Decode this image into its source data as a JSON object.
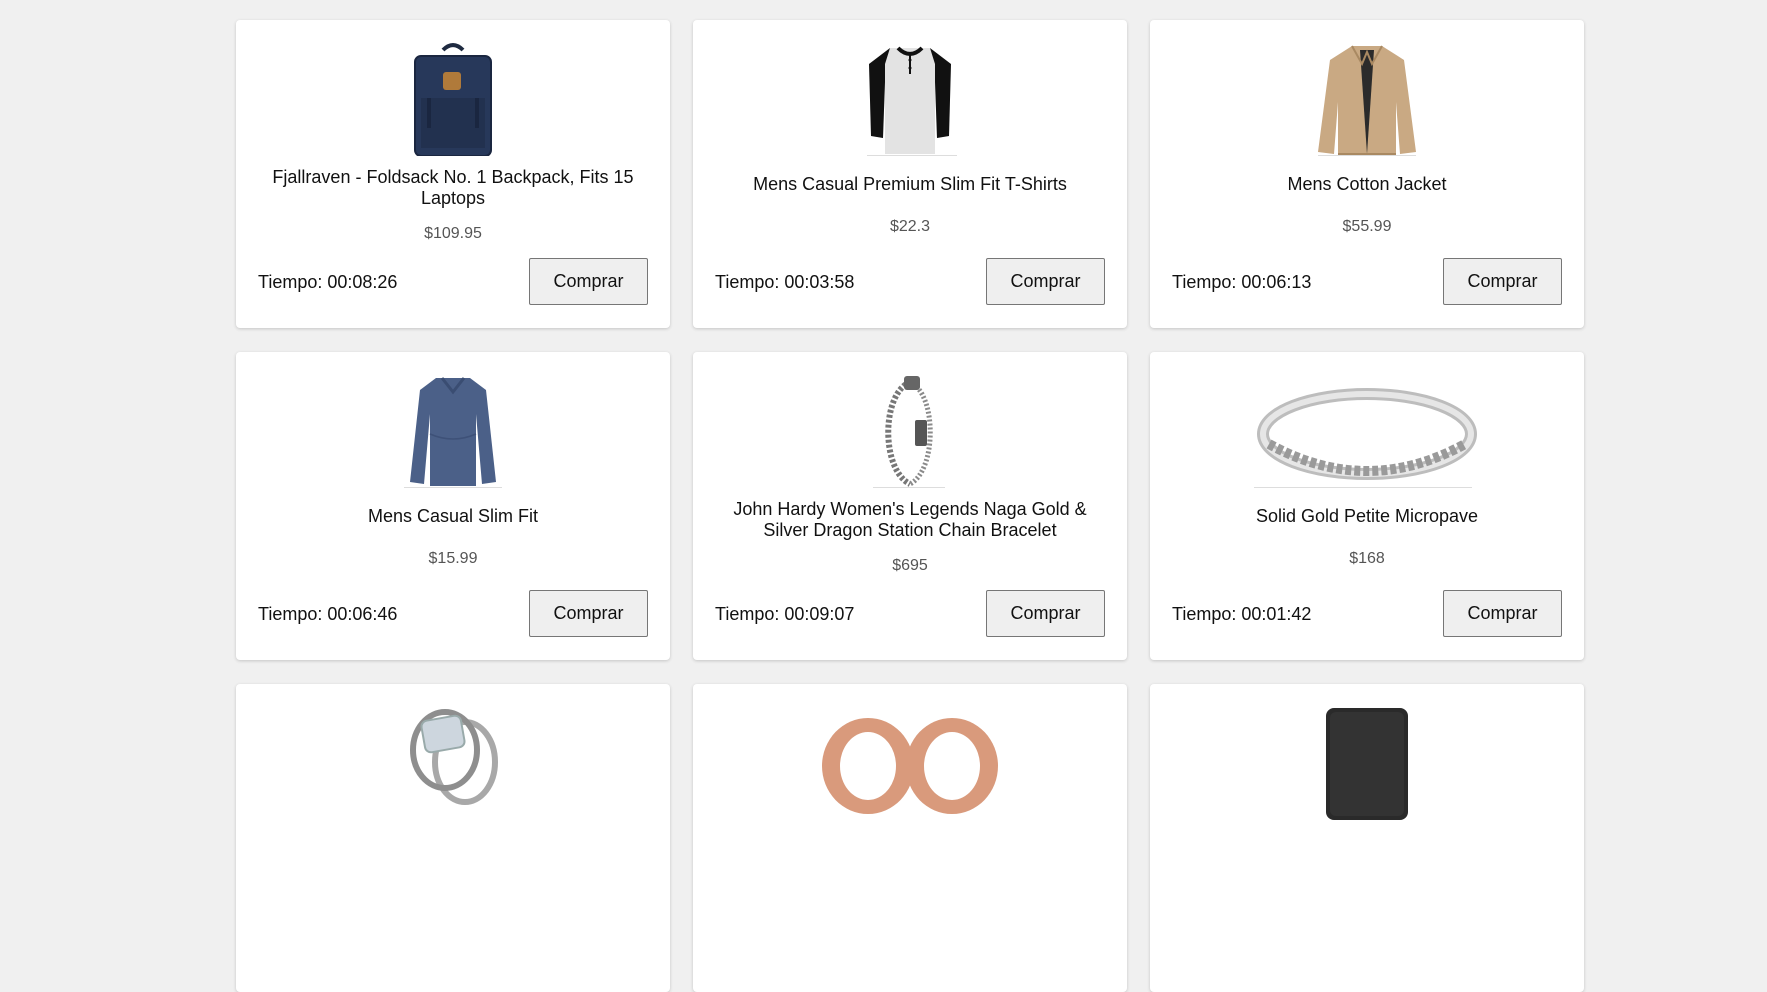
{
  "products": [
    {
      "title": "Fjallraven - Foldsack No. 1 Backpack, Fits 15 Laptops",
      "price": "$109.95",
      "timer": "Tiempo: 00:08:26",
      "button": "Comprar",
      "image": "backpack"
    },
    {
      "title": "Mens Casual Premium Slim Fit T-Shirts",
      "price": "$22.3",
      "timer": "Tiempo: 00:03:58",
      "button": "Comprar",
      "image": "tshirt"
    },
    {
      "title": "Mens Cotton Jacket",
      "price": "$55.99",
      "timer": "Tiempo: 00:06:13",
      "button": "Comprar",
      "image": "jacket"
    },
    {
      "title": "Mens Casual Slim Fit",
      "price": "$15.99",
      "timer": "Tiempo: 00:06:46",
      "button": "Comprar",
      "image": "longsleeve"
    },
    {
      "title": "John Hardy Women's Legends Naga Gold & Silver Dragon Station Chain Bracelet",
      "price": "$695",
      "timer": "Tiempo: 00:09:07",
      "button": "Comprar",
      "image": "bracelet"
    },
    {
      "title": "Solid Gold Petite Micropave",
      "price": "$168",
      "timer": "Tiempo: 00:01:42",
      "button": "Comprar",
      "image": "ring-band"
    },
    {
      "image": "ring-set"
    },
    {
      "image": "earrings-plugs"
    },
    {
      "image": "hard-drive"
    }
  ],
  "colors": {
    "page_bg": "#f0f0f0",
    "card_bg": "#ffffff",
    "price": "#555555",
    "button_bg": "#efefef"
  }
}
